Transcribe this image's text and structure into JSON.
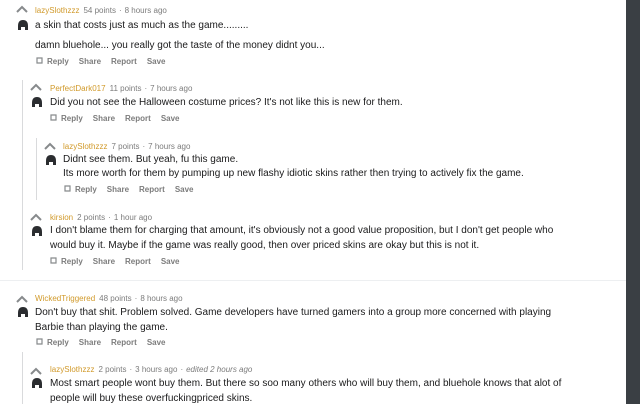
{
  "colors": {
    "username": "#d19a2b",
    "meta": "#7c7c7c",
    "text": "#1a1a1b",
    "strip": "#3a3f44"
  },
  "comments": [
    {
      "username": "lazySlothzzz",
      "points": "54 points",
      "time": "8 hours ago",
      "edited": "",
      "paragraphs": [
        "a skin that costs just as much as the game.........",
        "damn bluehole... you really got the taste of the money didnt you..."
      ]
    },
    {
      "username": "PerfectDark017",
      "points": "11 points",
      "time": "7 hours ago",
      "edited": "",
      "paragraphs": [
        "Did you not see the Halloween costume prices? It's not like this is new for them."
      ]
    },
    {
      "username": "lazySlothzzz",
      "points": "7 points",
      "time": "7 hours ago",
      "edited": "",
      "paragraphs": [
        "Didnt see them. But yeah, fu   this game.",
        "Its more worth for them by pumping up new flashy idiotic skins rather then trying to actively fix the game."
      ]
    },
    {
      "username": "kirsion",
      "points": "2 points",
      "time": "1 hour ago",
      "edited": "",
      "paragraphs": [
        "I don't blame them for charging that amount, it's obviously not a good value proposition, but I don't get people who would buy it. Maybe if the game was really good, then over priced skins are okay but this is not it."
      ]
    },
    {
      "username": "WickedTriggered",
      "points": "48 points",
      "time": "8 hours ago",
      "edited": "",
      "paragraphs": [
        "Don't buy that shit. Problem solved. Game developers have turned gamers into a group more concerned with playing Barbie than playing the game."
      ]
    },
    {
      "username": "lazySlothzzz",
      "points": "2 points",
      "time": "3 hours ago",
      "edited": "edited 2 hours ago",
      "paragraphs": [
        "Most smart people wont buy them. But there so soo many others who will buy them, and bluehole knows that alot of people will buy these overfuckingpriced skins."
      ]
    }
  ],
  "actions": {
    "reply": "Reply",
    "share": "Share",
    "report": "Report",
    "save": "Save"
  },
  "meta_separator": "·"
}
